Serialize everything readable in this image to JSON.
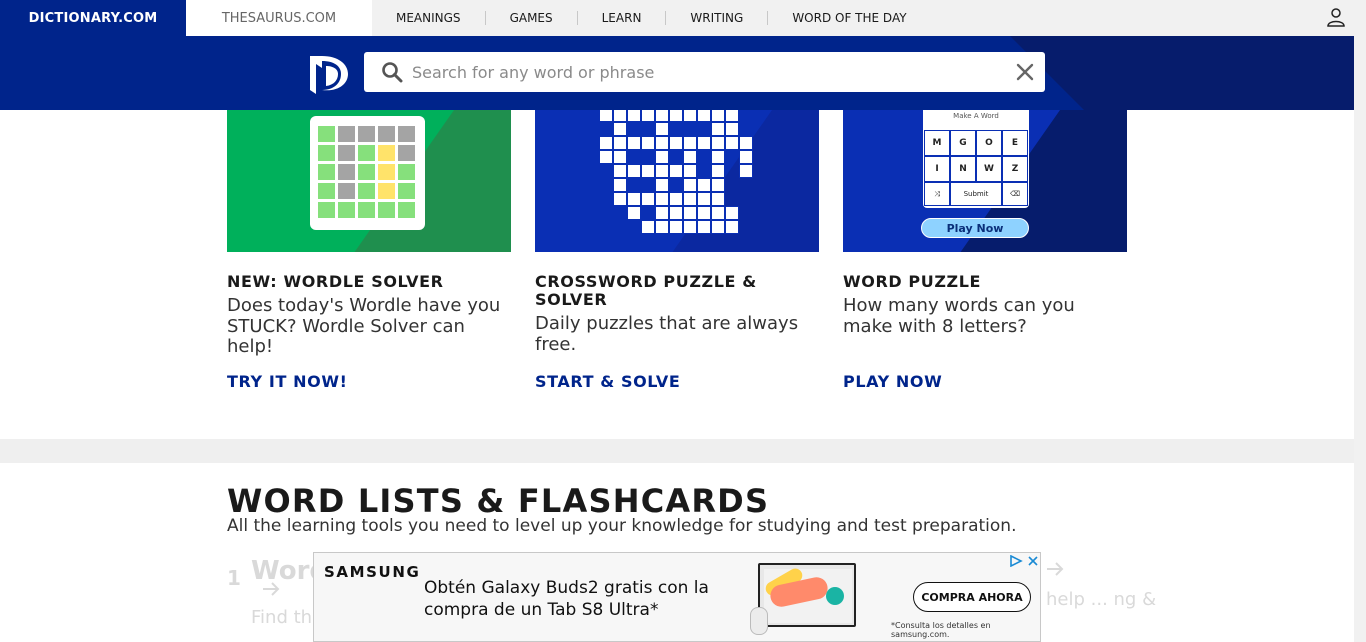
{
  "topbar": {
    "brand": "DICTIONARY.COM",
    "thesaurus": "THESAURUS.COM",
    "nav": [
      "MEANINGS",
      "GAMES",
      "LEARN",
      "WRITING",
      "WORD OF THE DAY"
    ]
  },
  "search": {
    "placeholder": "Search for any word or phrase"
  },
  "cards": [
    {
      "title": "NEW: WORDLE SOLVER",
      "description": "Does today's Wordle have you STUCK? Wordle Solver can help!",
      "cta": "TRY IT NOW!"
    },
    {
      "title": "CROSSWORD PUZZLE & SOLVER",
      "description": "Daily puzzles that are always free.",
      "cta": "START & SOLVE"
    },
    {
      "title": "WORD PUZZLE",
      "description": "How many words can you make with 8 letters?",
      "cta": "PLAY NOW"
    }
  ],
  "word_puzzle_thumb": {
    "label": "Make A Word",
    "letters": [
      "M",
      "G",
      "O",
      "E",
      "I",
      "N",
      "W",
      "Z"
    ],
    "submit": "Submit",
    "play_button": "Play Now"
  },
  "word_lists": {
    "title": "WORD LISTS & FLASHCARDS",
    "subtitle": "All the learning tools you need to level up your knowledge for studying and test preparation.",
    "item_number": "1",
    "item_title": "Word",
    "item_desc": "Find th... the Da...",
    "right_text": "help ... ng &"
  },
  "ad": {
    "brand": "SAMSUNG",
    "headline": "Obtén Galaxy Buds2 gratis con la compra de un Tab S8 Ultra*",
    "cta": "COMPRA AHORA",
    "note": "*Consulta los detalles en samsung.com."
  },
  "colors": {
    "brand_blue": "#00248b",
    "wordle_green": "#00b05b",
    "crossword_blue": "#0a2fb4"
  }
}
